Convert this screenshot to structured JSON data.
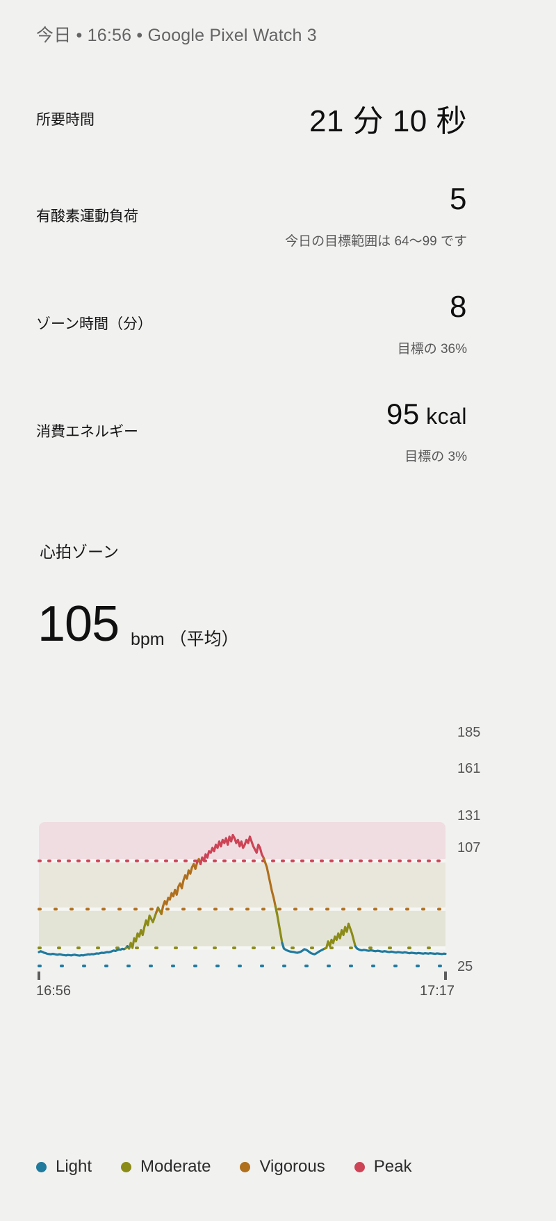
{
  "header": {
    "text": "今日 • 16:56 • Google Pixel Watch 3"
  },
  "summary": {
    "duration": {
      "label": "所要時間",
      "value": "21 分  10 秒"
    },
    "aerobic_load": {
      "label": "有酸素運動負荷",
      "value": "5",
      "sub": "今日の目標範囲は 64〜99 です"
    },
    "zone_minutes": {
      "label": "ゾーン時間（分）",
      "value": "8",
      "sub": "目標の 36%"
    },
    "energy": {
      "label": "消費エネルギー",
      "value": "95",
      "unit": " kcal",
      "sub": "目標の 3%"
    }
  },
  "heart_rate": {
    "section_title": "心拍ゾーン",
    "average_value": "105",
    "average_unit": "bpm （平均）"
  },
  "chart_data": {
    "type": "line",
    "title": "心拍ゾーン",
    "xlabel": "",
    "ylabel": "bpm",
    "x_ticks": [
      "16:56",
      "17:17"
    ],
    "y_ticks": [
      "185",
      "161",
      "131",
      "107",
      "25"
    ],
    "ylim": [
      25,
      185
    ],
    "grid": true,
    "legend_position": "bottom",
    "zones": [
      {
        "name": "Light",
        "color": "#1f7a9e",
        "min": 25,
        "max": 107,
        "band_color": "transparent"
      },
      {
        "name": "Moderate",
        "color": "#8b8b17",
        "min": 107,
        "max": 131,
        "band_color": "#e3e4d6"
      },
      {
        "name": "Vigorous",
        "color": "#b06f1c",
        "min": 131,
        "max": 161,
        "band_color": "#e9e7dc"
      },
      {
        "name": "Peak",
        "color": "#cc4456",
        "min": 161,
        "max": 185,
        "band_color": "#efdde1"
      }
    ],
    "series": [
      {
        "name": "Heart rate",
        "unit": "bpm",
        "values": [
          88,
          92,
          89,
          85,
          83,
          80,
          79,
          78,
          80,
          79,
          77,
          76,
          78,
          77,
          75,
          74,
          73,
          75,
          74,
          73,
          75,
          76,
          74,
          73,
          72,
          74,
          73,
          75,
          76,
          78,
          77,
          79,
          78,
          80,
          82,
          81,
          83,
          85,
          84,
          86,
          88,
          87,
          89,
          92,
          95,
          93,
          97,
          100,
          99,
          103,
          101,
          105,
          108,
          104,
          110,
          107,
          113,
          111,
          116,
          114,
          118,
          115,
          120,
          124,
          121,
          127,
          125,
          123,
          126,
          129,
          132,
          130,
          128,
          133,
          136,
          134,
          138,
          137,
          141,
          139,
          143,
          140,
          145,
          147,
          144,
          149,
          152,
          150,
          155,
          153,
          157,
          159,
          156,
          160,
          162,
          159,
          163,
          161,
          165,
          163,
          167,
          166,
          169,
          167,
          171,
          169,
          173,
          170,
          174,
          172,
          175,
          171,
          176,
          173,
          177,
          175,
          172,
          174,
          170,
          173,
          169,
          171,
          174,
          172,
          176,
          173,
          170,
          168,
          166,
          171,
          169,
          165,
          163,
          160,
          157,
          152,
          147,
          142,
          138,
          133,
          128,
          122,
          116,
          110,
          104,
          99,
          95,
          92,
          90,
          89,
          88,
          86,
          85,
          87,
          90,
          95,
          101,
          99,
          94,
          88,
          83,
          80,
          78,
          82,
          87,
          92,
          96,
          100,
          104,
          107,
          111,
          108,
          112,
          110,
          114,
          112,
          116,
          113,
          118,
          115,
          120,
          117,
          122,
          119,
          116,
          112,
          108,
          104,
          100,
          97,
          96,
          98,
          97,
          95,
          94,
          96,
          95,
          93,
          92,
          94,
          93,
          91,
          90,
          92,
          91,
          89,
          88,
          90,
          89,
          87,
          86,
          88,
          87,
          86,
          85,
          87,
          86,
          84,
          83,
          85,
          84,
          83,
          82,
          84,
          83,
          82,
          81,
          83,
          82,
          81,
          83,
          82,
          81,
          80,
          82,
          81,
          80,
          79,
          81,
          80
        ]
      }
    ]
  },
  "legend": {
    "items": [
      {
        "label": "Light",
        "color": "#1f7a9e"
      },
      {
        "label": "Moderate",
        "color": "#8b8b17"
      },
      {
        "label": "Vigorous",
        "color": "#b06f1c"
      },
      {
        "label": "Peak",
        "color": "#cc4456"
      }
    ]
  }
}
